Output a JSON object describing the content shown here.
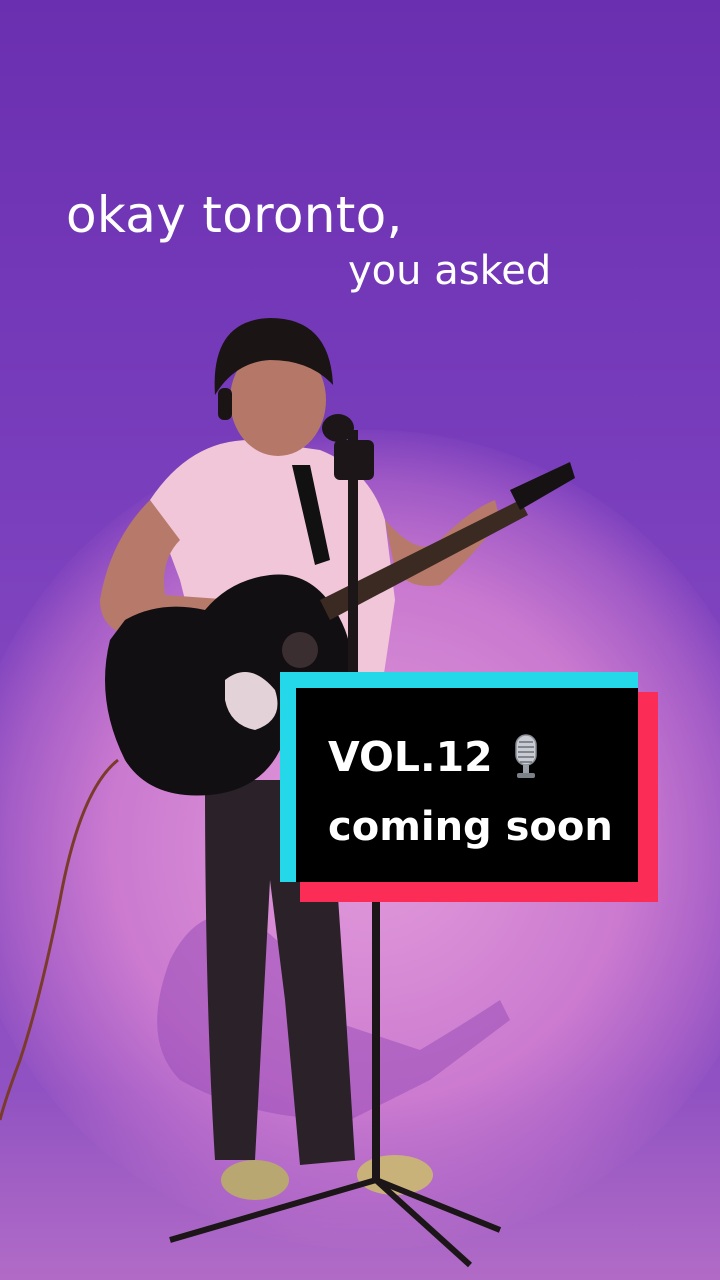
{
  "video": {
    "headline": "okay toronto,",
    "subline": "you asked"
  },
  "badge": {
    "line1": "VOL.12",
    "icon": "studio-microphone-icon",
    "line2": "coming soon"
  },
  "colors": {
    "background_purple": "#6a2fb0",
    "spotlight_pink": "#e8a0dc",
    "badge_cyan": "#25d8e9",
    "badge_red": "#fb2c55",
    "badge_black": "#000000",
    "text_white": "#ffffff"
  }
}
